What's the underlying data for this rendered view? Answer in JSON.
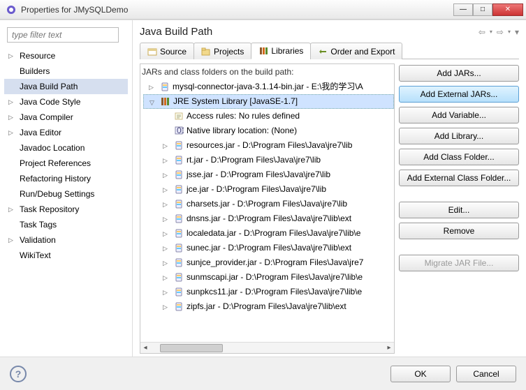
{
  "window": {
    "title": "Properties for JMySQLDemo"
  },
  "filter": {
    "placeholder": "type filter text"
  },
  "nav": {
    "items": [
      {
        "label": "Resource",
        "parent": true
      },
      {
        "label": "Builders"
      },
      {
        "label": "Java Build Path",
        "selected": true
      },
      {
        "label": "Java Code Style",
        "parent": true
      },
      {
        "label": "Java Compiler",
        "parent": true
      },
      {
        "label": "Java Editor",
        "parent": true
      },
      {
        "label": "Javadoc Location"
      },
      {
        "label": "Project References"
      },
      {
        "label": "Refactoring History"
      },
      {
        "label": "Run/Debug Settings"
      },
      {
        "label": "Task Repository",
        "parent": true
      },
      {
        "label": "Task Tags"
      },
      {
        "label": "Validation",
        "parent": true
      },
      {
        "label": "WikiText"
      }
    ]
  },
  "rightPane": {
    "title": "Java Build Path",
    "tabs": [
      {
        "label": "Source"
      },
      {
        "label": "Projects"
      },
      {
        "label": "Libraries",
        "active": true
      },
      {
        "label": "Order and Export"
      }
    ],
    "caption": "JARs and class folders on the build path:",
    "tree": [
      {
        "label": "mysql-connector-java-3.1.14-bin.jar - E:\\我的学习\\A",
        "type": "jar"
      },
      {
        "label": "JRE System Library [JavaSE-1.7]",
        "type": "lib",
        "expanded": true,
        "selected": true
      },
      {
        "label": "Access rules: No rules defined",
        "type": "rule",
        "child": true,
        "noexp": true
      },
      {
        "label": "Native library location: (None)",
        "type": "native",
        "child": true,
        "noexp": true
      },
      {
        "label": "resources.jar - D:\\Program Files\\Java\\jre7\\lib",
        "type": "jar",
        "child": true
      },
      {
        "label": "rt.jar - D:\\Program Files\\Java\\jre7\\lib",
        "type": "jar",
        "child": true
      },
      {
        "label": "jsse.jar - D:\\Program Files\\Java\\jre7\\lib",
        "type": "jar",
        "child": true
      },
      {
        "label": "jce.jar - D:\\Program Files\\Java\\jre7\\lib",
        "type": "jar",
        "child": true
      },
      {
        "label": "charsets.jar - D:\\Program Files\\Java\\jre7\\lib",
        "type": "jar",
        "child": true
      },
      {
        "label": "dnsns.jar - D:\\Program Files\\Java\\jre7\\lib\\ext",
        "type": "jar",
        "child": true
      },
      {
        "label": "localedata.jar - D:\\Program Files\\Java\\jre7\\lib\\e",
        "type": "jar",
        "child": true
      },
      {
        "label": "sunec.jar - D:\\Program Files\\Java\\jre7\\lib\\ext",
        "type": "jar",
        "child": true
      },
      {
        "label": "sunjce_provider.jar - D:\\Program Files\\Java\\jre7",
        "type": "jar",
        "child": true
      },
      {
        "label": "sunmscapi.jar - D:\\Program Files\\Java\\jre7\\lib\\e",
        "type": "jar",
        "child": true
      },
      {
        "label": "sunpkcs11.jar - D:\\Program Files\\Java\\jre7\\lib\\e",
        "type": "jar",
        "child": true
      },
      {
        "label": "zipfs.jar - D:\\Program Files\\Java\\jre7\\lib\\ext",
        "type": "jar",
        "child": true
      }
    ],
    "buttons": {
      "addJars": "Add JARs...",
      "addExternalJars": "Add External JARs...",
      "addVariable": "Add Variable...",
      "addLibrary": "Add Library...",
      "addClassFolder": "Add Class Folder...",
      "addExternalClassFolder": "Add External Class Folder...",
      "edit": "Edit...",
      "remove": "Remove",
      "migrate": "Migrate JAR File..."
    }
  },
  "footer": {
    "ok": "OK",
    "cancel": "Cancel"
  }
}
